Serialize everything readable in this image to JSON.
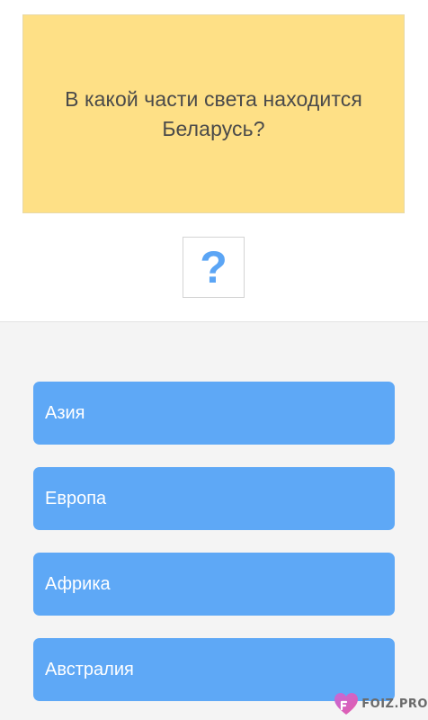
{
  "question": {
    "text": "В какой части света находится Беларусь?"
  },
  "hint": {
    "glyph": "?",
    "icon": "question-mark-icon"
  },
  "answers": [
    {
      "label": "Азия"
    },
    {
      "label": "Европа"
    },
    {
      "label": "Африка"
    },
    {
      "label": "Австралия"
    }
  ],
  "watermark": {
    "text": "FOIZ.PRO"
  },
  "colors": {
    "question_card": "#fee086",
    "answer_button": "#5ea8f6",
    "hint_glyph": "#5ba5f5",
    "answers_background": "#f4f4f4"
  }
}
